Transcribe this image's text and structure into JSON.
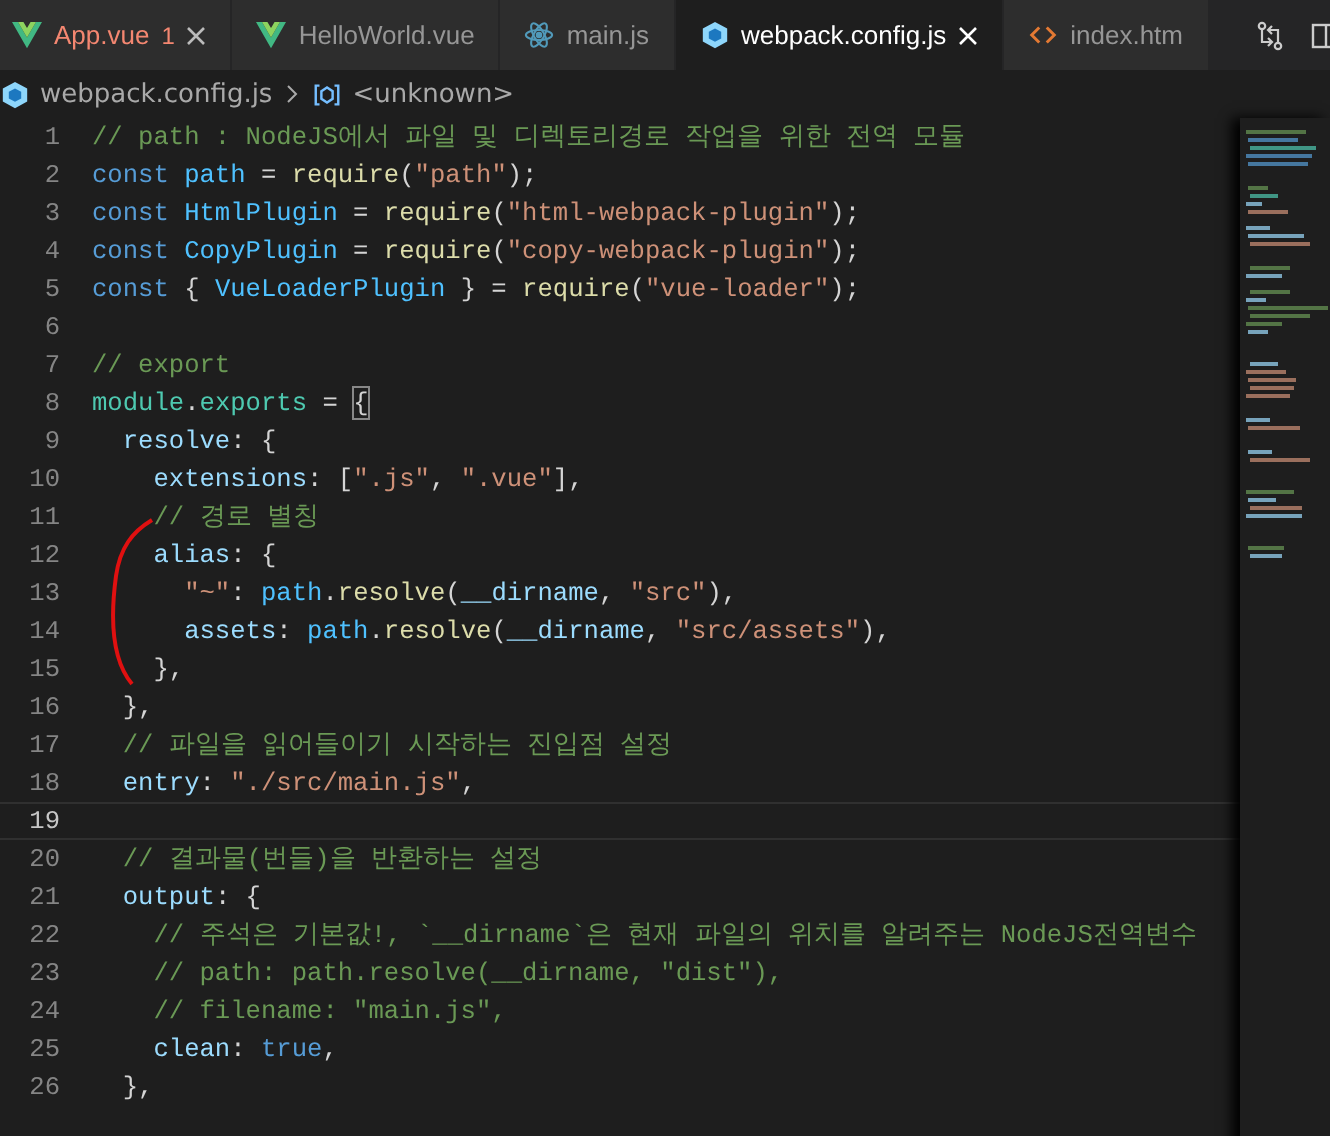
{
  "tabs": [
    {
      "label": "App.vue",
      "kind": "vue",
      "error": true,
      "problems": "1",
      "selected": false,
      "closable": true
    },
    {
      "label": "HelloWorld.vue",
      "kind": "vue",
      "error": false,
      "selected": false,
      "closable": false
    },
    {
      "label": "main.js",
      "kind": "js",
      "error": false,
      "selected": false,
      "closable": false
    },
    {
      "label": "webpack.config.js",
      "kind": "webpack",
      "error": false,
      "selected": true,
      "closable": true
    },
    {
      "label": "index.htm",
      "kind": "html",
      "error": false,
      "selected": false,
      "closable": false
    }
  ],
  "breadcrumb": [
    {
      "label": "webpack.config.js",
      "kind": "file"
    },
    {
      "label": "<unknown>",
      "kind": "symbol"
    }
  ],
  "editor": {
    "lines": [
      {
        "number": "1",
        "current": false,
        "tokens": [
          {
            "kind": "comment",
            "text": "// path : NodeJS에서 파일 및 디렉토리경로 작업을 위한 전역 모듈"
          }
        ]
      },
      {
        "number": "2",
        "current": false,
        "tokens": [
          {
            "kind": "keyword",
            "text": "const "
          },
          {
            "kind": "constant",
            "text": "path"
          },
          {
            "kind": "punct",
            "text": " = "
          },
          {
            "kind": "function",
            "text": "require"
          },
          {
            "kind": "punct",
            "text": "("
          },
          {
            "kind": "string",
            "text": "\"path\""
          },
          {
            "kind": "punct",
            "text": ");"
          }
        ]
      },
      {
        "number": "3",
        "current": false,
        "tokens": [
          {
            "kind": "keyword",
            "text": "const "
          },
          {
            "kind": "constant",
            "text": "HtmlPlugin"
          },
          {
            "kind": "punct",
            "text": " = "
          },
          {
            "kind": "function",
            "text": "require"
          },
          {
            "kind": "punct",
            "text": "("
          },
          {
            "kind": "string",
            "text": "\"html-webpack-plugin\""
          },
          {
            "kind": "punct",
            "text": ");"
          }
        ]
      },
      {
        "number": "4",
        "current": false,
        "tokens": [
          {
            "kind": "keyword",
            "text": "const "
          },
          {
            "kind": "constant",
            "text": "CopyPlugin"
          },
          {
            "kind": "punct",
            "text": " = "
          },
          {
            "kind": "function",
            "text": "require"
          },
          {
            "kind": "punct",
            "text": "("
          },
          {
            "kind": "string",
            "text": "\"copy-webpack-plugin\""
          },
          {
            "kind": "punct",
            "text": ");"
          }
        ]
      },
      {
        "number": "5",
        "current": false,
        "tokens": [
          {
            "kind": "keyword",
            "text": "const "
          },
          {
            "kind": "punct",
            "text": "{ "
          },
          {
            "kind": "constant",
            "text": "VueLoaderPlugin"
          },
          {
            "kind": "punct",
            "text": " } = "
          },
          {
            "kind": "function",
            "text": "require"
          },
          {
            "kind": "punct",
            "text": "("
          },
          {
            "kind": "string",
            "text": "\"vue-loader\""
          },
          {
            "kind": "punct",
            "text": ");"
          }
        ]
      },
      {
        "number": "6",
        "current": false
      },
      {
        "number": "7",
        "current": false,
        "tokens": [
          {
            "kind": "comment",
            "text": "// export"
          }
        ]
      },
      {
        "number": "8",
        "current": false,
        "tokens": [
          {
            "kind": "type",
            "text": "module"
          },
          {
            "kind": "punct",
            "text": "."
          },
          {
            "kind": "type",
            "text": "exports"
          },
          {
            "kind": "punct",
            "text": " = "
          },
          {
            "kind": "bracket",
            "text": "{"
          }
        ]
      },
      {
        "number": "9",
        "current": false,
        "tokens": [
          {
            "kind": "property",
            "text": "  resolve"
          },
          {
            "kind": "punct",
            "text": ": {"
          }
        ]
      },
      {
        "number": "10",
        "current": false,
        "tokens": [
          {
            "kind": "property",
            "text": "    extensions"
          },
          {
            "kind": "punct",
            "text": ": ["
          },
          {
            "kind": "string",
            "text": "\".js\""
          },
          {
            "kind": "punct",
            "text": ", "
          },
          {
            "kind": "string",
            "text": "\".vue\""
          },
          {
            "kind": "punct",
            "text": "],"
          }
        ]
      },
      {
        "number": "11",
        "current": false,
        "tokens": [
          {
            "kind": "comment",
            "text": "    // 경로 별칭"
          }
        ]
      },
      {
        "number": "12",
        "current": false,
        "tokens": [
          {
            "kind": "property",
            "text": "    alias"
          },
          {
            "kind": "punct",
            "text": ": {"
          }
        ]
      },
      {
        "number": "13",
        "current": false,
        "tokens": [
          {
            "kind": "string",
            "text": "      \"~\""
          },
          {
            "kind": "punct",
            "text": ": "
          },
          {
            "kind": "constant",
            "text": "path"
          },
          {
            "kind": "punct",
            "text": "."
          },
          {
            "kind": "function",
            "text": "resolve"
          },
          {
            "kind": "punct",
            "text": "("
          },
          {
            "kind": "property",
            "text": "__dirname"
          },
          {
            "kind": "punct",
            "text": ", "
          },
          {
            "kind": "string",
            "text": "\"src\""
          },
          {
            "kind": "punct",
            "text": "),"
          }
        ]
      },
      {
        "number": "14",
        "current": false,
        "tokens": [
          {
            "kind": "property",
            "text": "      assets"
          },
          {
            "kind": "punct",
            "text": ": "
          },
          {
            "kind": "constant",
            "text": "path"
          },
          {
            "kind": "punct",
            "text": "."
          },
          {
            "kind": "function",
            "text": "resolve"
          },
          {
            "kind": "punct",
            "text": "("
          },
          {
            "kind": "property",
            "text": "__dirname"
          },
          {
            "kind": "punct",
            "text": ", "
          },
          {
            "kind": "string",
            "text": "\"src/assets\""
          },
          {
            "kind": "punct",
            "text": "),"
          }
        ]
      },
      {
        "number": "15",
        "current": false,
        "tokens": [
          {
            "kind": "punct",
            "text": "    },"
          }
        ]
      },
      {
        "number": "16",
        "current": false,
        "tokens": [
          {
            "kind": "punct",
            "text": "  },"
          }
        ]
      },
      {
        "number": "17",
        "current": false,
        "tokens": [
          {
            "kind": "comment",
            "text": "  // 파일을 읽어들이기 시작하는 진입점 설정"
          }
        ]
      },
      {
        "number": "18",
        "current": false,
        "tokens": [
          {
            "kind": "property",
            "text": "  entry"
          },
          {
            "kind": "punct",
            "text": ": "
          },
          {
            "kind": "string",
            "text": "\"./src/main.js\""
          },
          {
            "kind": "punct",
            "text": ","
          }
        ]
      },
      {
        "number": "19",
        "current": true
      },
      {
        "number": "20",
        "current": false,
        "tokens": [
          {
            "kind": "comment",
            "text": "  // 결과물(번들)을 반환하는 설정"
          }
        ]
      },
      {
        "number": "21",
        "current": false,
        "tokens": [
          {
            "kind": "property",
            "text": "  output"
          },
          {
            "kind": "punct",
            "text": ": {"
          }
        ]
      },
      {
        "number": "22",
        "current": false,
        "tokens": [
          {
            "kind": "comment",
            "text": "    // 주석은 기본값!, `__dirname`은 현재 파일의 위치를 알려주는 NodeJS전역변수"
          }
        ]
      },
      {
        "number": "23",
        "current": false,
        "tokens": [
          {
            "kind": "comment",
            "text": "    // path: path.resolve(__dirname, \"dist\"),"
          }
        ]
      },
      {
        "number": "24",
        "current": false,
        "tokens": [
          {
            "kind": "comment",
            "text": "    // filename: \"main.js\","
          }
        ]
      },
      {
        "number": "25",
        "current": false,
        "tokens": [
          {
            "kind": "property",
            "text": "    clean"
          },
          {
            "kind": "punct",
            "text": ": "
          },
          {
            "kind": "keyword",
            "text": "true"
          },
          {
            "kind": "punct",
            "text": ","
          }
        ]
      },
      {
        "number": "26",
        "current": false,
        "tokens": [
          {
            "kind": "punct",
            "text": "  },"
          }
        ]
      }
    ]
  }
}
